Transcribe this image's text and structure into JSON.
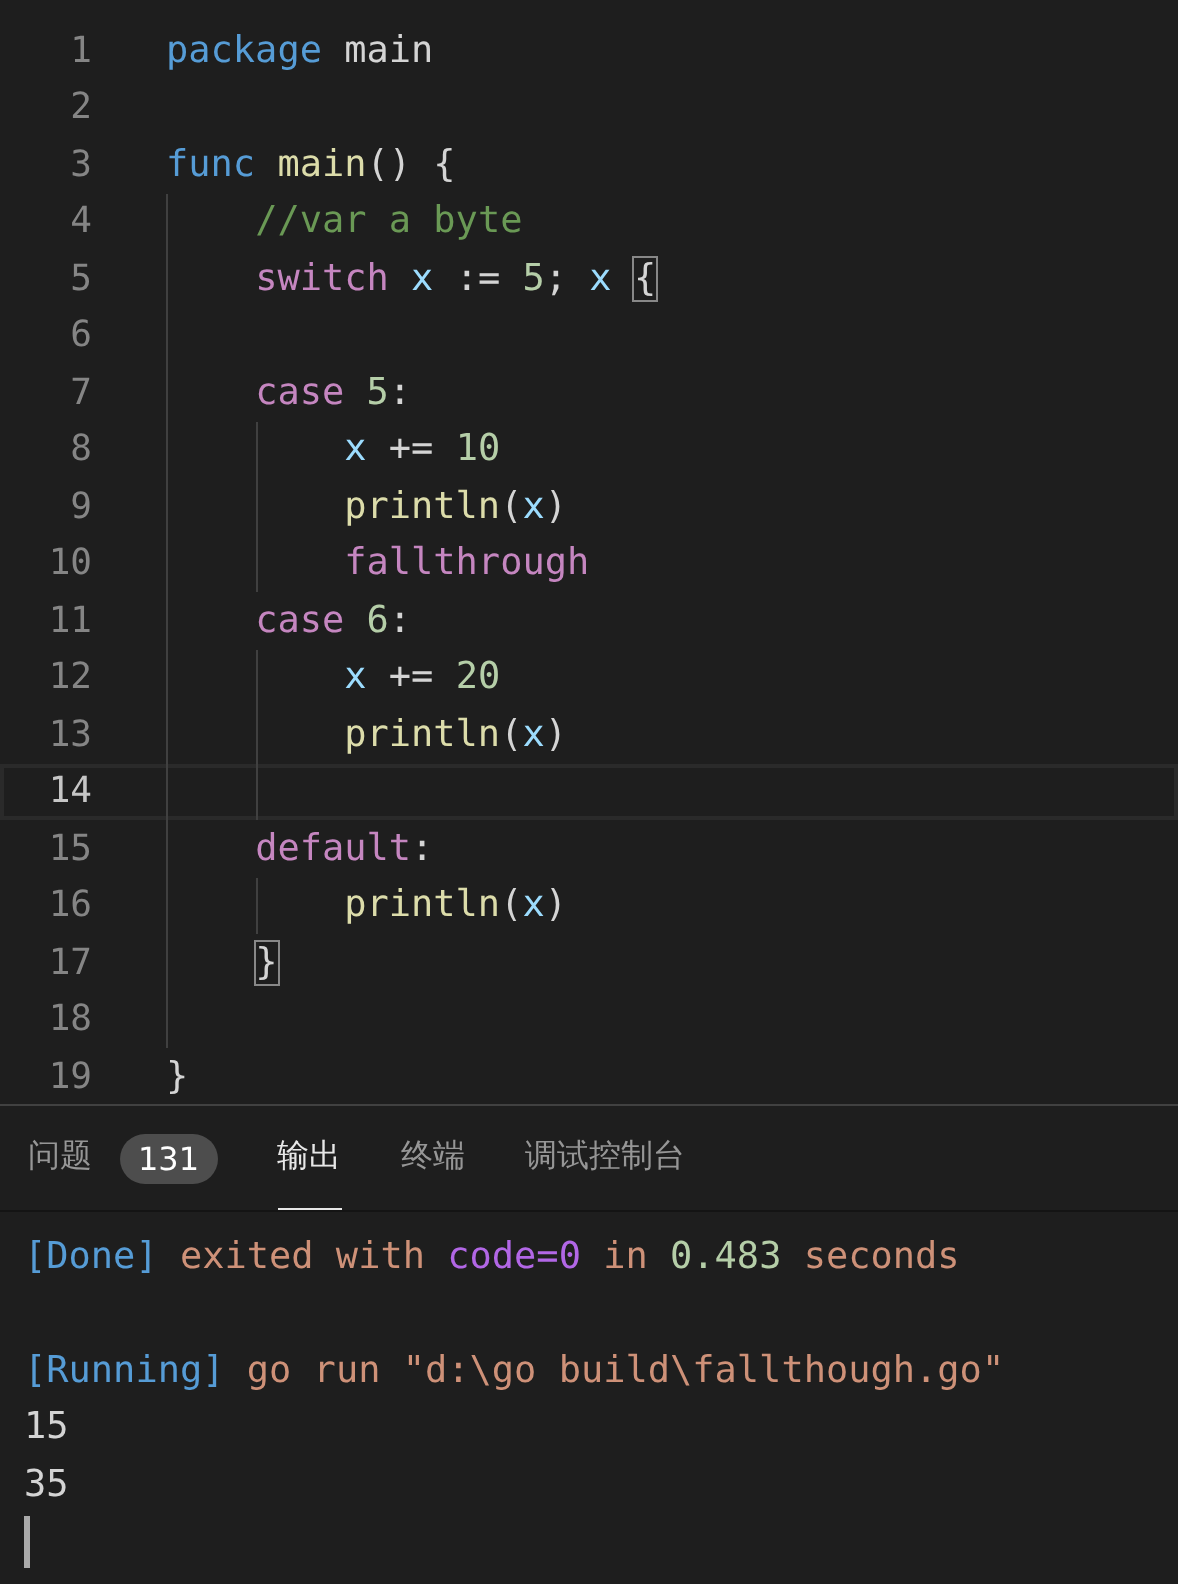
{
  "editor": {
    "lines": [
      {
        "number": "1",
        "current": false,
        "tokens": [
          {
            "kind": "keyword",
            "text": "package"
          },
          {
            "kind": "plain",
            "text": " main"
          }
        ]
      },
      {
        "number": "2",
        "current": false
      },
      {
        "number": "3",
        "current": false,
        "tokens": [
          {
            "kind": "keyword",
            "text": "func"
          },
          {
            "kind": "function",
            "text": " main"
          },
          {
            "kind": "plain",
            "text": "() {"
          }
        ]
      },
      {
        "number": "4",
        "current": false,
        "tokens": [
          {
            "kind": "comment",
            "text": "    //var a byte"
          }
        ]
      },
      {
        "number": "5",
        "current": false,
        "tokens": [
          {
            "kind": "control",
            "text": "    switch"
          },
          {
            "kind": "variable",
            "text": " x"
          },
          {
            "kind": "plain",
            "text": " := "
          },
          {
            "kind": "number",
            "text": "5"
          },
          {
            "kind": "plain",
            "text": "; "
          },
          {
            "kind": "variable",
            "text": "x"
          },
          {
            "kind": "match",
            "text": " {"
          }
        ]
      },
      {
        "number": "6",
        "current": false
      },
      {
        "number": "7",
        "current": false,
        "tokens": [
          {
            "kind": "control",
            "text": "    case"
          },
          {
            "kind": "number",
            "text": " 5"
          },
          {
            "kind": "plain",
            "text": ":"
          }
        ]
      },
      {
        "number": "8",
        "current": false,
        "tokens": [
          {
            "kind": "variable",
            "text": "        x"
          },
          {
            "kind": "plain",
            "text": " += "
          },
          {
            "kind": "number",
            "text": "10"
          }
        ]
      },
      {
        "number": "9",
        "current": false,
        "tokens": [
          {
            "kind": "function",
            "text": "        println"
          },
          {
            "kind": "plain",
            "text": "("
          },
          {
            "kind": "variable",
            "text": "x"
          },
          {
            "kind": "plain",
            "text": ")"
          }
        ]
      },
      {
        "number": "10",
        "current": false,
        "tokens": [
          {
            "kind": "control",
            "text": "        fallthrough"
          }
        ]
      },
      {
        "number": "11",
        "current": false,
        "tokens": [
          {
            "kind": "control",
            "text": "    case"
          },
          {
            "kind": "number",
            "text": " 6"
          },
          {
            "kind": "plain",
            "text": ":"
          }
        ]
      },
      {
        "number": "12",
        "current": false,
        "tokens": [
          {
            "kind": "variable",
            "text": "        x"
          },
          {
            "kind": "plain",
            "text": " += "
          },
          {
            "kind": "number",
            "text": "20"
          }
        ]
      },
      {
        "number": "13",
        "current": false,
        "tokens": [
          {
            "kind": "function",
            "text": "        println"
          },
          {
            "kind": "plain",
            "text": "("
          },
          {
            "kind": "variable",
            "text": "x"
          },
          {
            "kind": "plain",
            "text": ")"
          }
        ]
      },
      {
        "number": "14",
        "current": true
      },
      {
        "number": "15",
        "current": false,
        "tokens": [
          {
            "kind": "control",
            "text": "    default"
          },
          {
            "kind": "plain",
            "text": ":"
          }
        ]
      },
      {
        "number": "16",
        "current": false,
        "tokens": [
          {
            "kind": "function",
            "text": "        println"
          },
          {
            "kind": "plain",
            "text": "("
          },
          {
            "kind": "variable",
            "text": "x"
          },
          {
            "kind": "plain",
            "text": ")"
          }
        ]
      },
      {
        "number": "17",
        "current": false,
        "tokens": [
          {
            "kind": "match",
            "text": "    }"
          }
        ]
      },
      {
        "number": "18",
        "current": false
      },
      {
        "number": "19",
        "current": false,
        "tokens": [
          {
            "kind": "plain",
            "text": "}"
          }
        ]
      }
    ]
  },
  "panel": {
    "tabs": [
      {
        "label": "问题",
        "selected": false,
        "badge": "131"
      },
      {
        "label": "输出",
        "selected": true
      },
      {
        "label": "终端",
        "selected": false
      },
      {
        "label": "调试控制台",
        "selected": false
      }
    ],
    "output": [
      {
        "kind": "text",
        "tokens": [
          {
            "kind": "bracket",
            "text": "[Done]"
          },
          {
            "kind": "string",
            "text": " exited with "
          },
          {
            "kind": "keyword",
            "text": "code=0"
          },
          {
            "kind": "string",
            "text": " in "
          },
          {
            "kind": "number",
            "text": "0.483"
          },
          {
            "kind": "string",
            "text": " seconds"
          }
        ]
      },
      {
        "kind": "blank"
      },
      {
        "kind": "text",
        "tokens": [
          {
            "kind": "bracket",
            "text": "[Running]"
          },
          {
            "kind": "string",
            "text": " go run \"d:\\go build\\fallthough.go\""
          }
        ]
      },
      {
        "kind": "text",
        "tokens": [
          {
            "kind": "plain",
            "text": "15"
          }
        ]
      },
      {
        "kind": "text",
        "tokens": [
          {
            "kind": "plain",
            "text": "35"
          }
        ]
      },
      {
        "kind": "cursor"
      }
    ]
  }
}
